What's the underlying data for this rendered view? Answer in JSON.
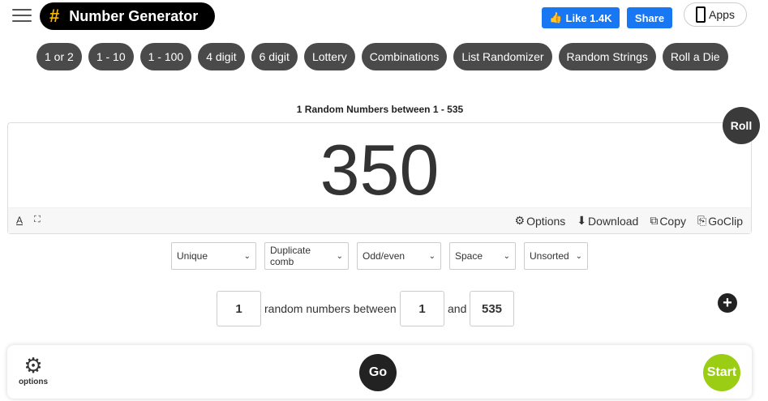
{
  "header": {
    "brand_symbol": "#",
    "brand_title": "Number Generator",
    "fb_like_label": "Like 1.4K",
    "fb_share_label": "Share",
    "apps_label": "Apps"
  },
  "categories": [
    "1 or 2",
    "1 - 10",
    "1 - 100",
    "4 digit",
    "6 digit",
    "Lottery",
    "Combinations",
    "List Randomizer",
    "Random Strings",
    "Roll a Die"
  ],
  "result": {
    "heading": "1 Random Numbers between 1 - 535",
    "number": "350",
    "roll_label": "Roll",
    "tools": {
      "options_label": "Options",
      "download_label": "Download",
      "copy_label": "Copy",
      "goclip_label": "GoClip"
    }
  },
  "selects": [
    "Unique",
    "Duplicate comb",
    "Odd/even",
    "Space",
    "Unsorted"
  ],
  "generator": {
    "count": "1",
    "between_label": "random numbers between",
    "min": "1",
    "and_label": "and",
    "max": "535",
    "add_label": "+"
  },
  "bottom": {
    "options_label": "options",
    "go_label": "Go",
    "start_label": "Start"
  },
  "colors": {
    "brand_bg": "#000000",
    "brand_hash": "#f5b800",
    "facebook": "#1877f2",
    "pill_bg": "#4a4a4a",
    "start_green": "#9acd14"
  }
}
